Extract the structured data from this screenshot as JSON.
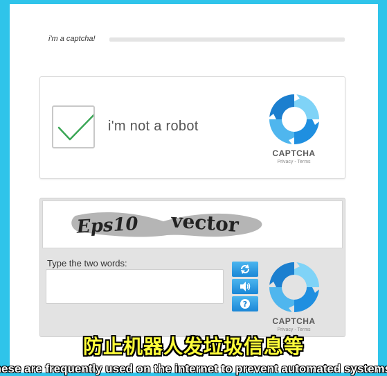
{
  "header": {
    "label": "i'm a captcha!"
  },
  "checkbox_widget": {
    "label": "i'm not a robot",
    "checked": true,
    "brand": "CAPTCHA",
    "links": "Privacy - Terms"
  },
  "text_widget": {
    "words": [
      "Eps10",
      "vector"
    ],
    "prompt": "Type the two words:",
    "answer_value": "",
    "controls": [
      {
        "icon": "refresh-icon"
      },
      {
        "icon": "audio-icon"
      },
      {
        "icon": "help-icon"
      }
    ],
    "brand": "CAPTCHA",
    "links": "Privacy - Terms"
  },
  "subtitles": {
    "chinese": "防止机器人发垃圾信息等",
    "english": "these are frequently used on the internet to prevent automated systems"
  },
  "colors": {
    "background": "#2fc4ea",
    "check": "#3aa655",
    "logo_blue": "#1f8fe0",
    "logo_light": "#7fd3f7",
    "subtitle_yellow": "#ffff3a"
  }
}
